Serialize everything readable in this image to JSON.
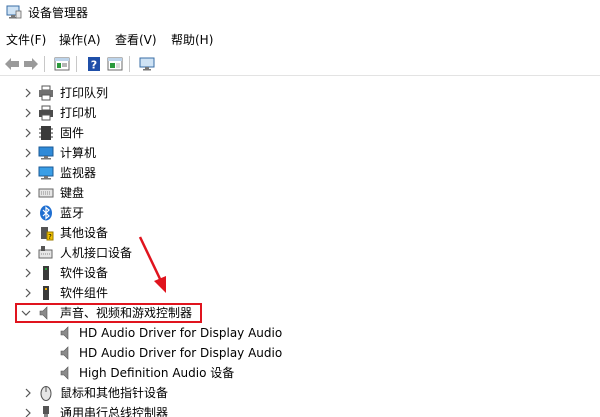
{
  "window": {
    "title": "设备管理器"
  },
  "menu": [
    {
      "label": "文件(F)"
    },
    {
      "label": "操作(A)"
    },
    {
      "label": "查看(V)"
    },
    {
      "label": "帮助(H)"
    }
  ],
  "toolbar": [
    "back-icon",
    "forward-icon",
    "properties-icon",
    "help-icon",
    "show-hide-icon",
    "monitor-icon"
  ],
  "tree": [
    {
      "label": "打印队列",
      "icon": "print-queue-icon",
      "expanded": false
    },
    {
      "label": "打印机",
      "icon": "printer-icon",
      "expanded": false
    },
    {
      "label": "固件",
      "icon": "firmware-icon",
      "expanded": false
    },
    {
      "label": "计算机",
      "icon": "computer-icon",
      "expanded": false
    },
    {
      "label": "监视器",
      "icon": "monitor-icon",
      "expanded": false
    },
    {
      "label": "键盘",
      "icon": "keyboard-icon",
      "expanded": false
    },
    {
      "label": "蓝牙",
      "icon": "bluetooth-icon",
      "expanded": false
    },
    {
      "label": "其他设备",
      "icon": "other-devices-icon",
      "expanded": false
    },
    {
      "label": "人机接口设备",
      "icon": "hid-icon",
      "expanded": false
    },
    {
      "label": "软件设备",
      "icon": "software-device-icon",
      "expanded": false
    },
    {
      "label": "软件组件",
      "icon": "software-component-icon",
      "expanded": false
    },
    {
      "label": "声音、视频和游戏控制器",
      "icon": "speaker-icon",
      "expanded": true,
      "children": [
        {
          "label": "HD Audio Driver for Display Audio",
          "icon": "speaker-icon"
        },
        {
          "label": "HD Audio Driver for Display Audio",
          "icon": "speaker-icon"
        },
        {
          "label": "High Definition Audio 设备",
          "icon": "speaker-icon"
        }
      ]
    },
    {
      "label": "鼠标和其他指针设备",
      "icon": "mouse-icon",
      "expanded": false
    },
    {
      "label": "通用串行总线控制器",
      "icon": "usb-icon",
      "expanded": false
    }
  ],
  "annotation": {
    "highlight_color": "#e0141e",
    "arrow_color": "#e0141e"
  }
}
